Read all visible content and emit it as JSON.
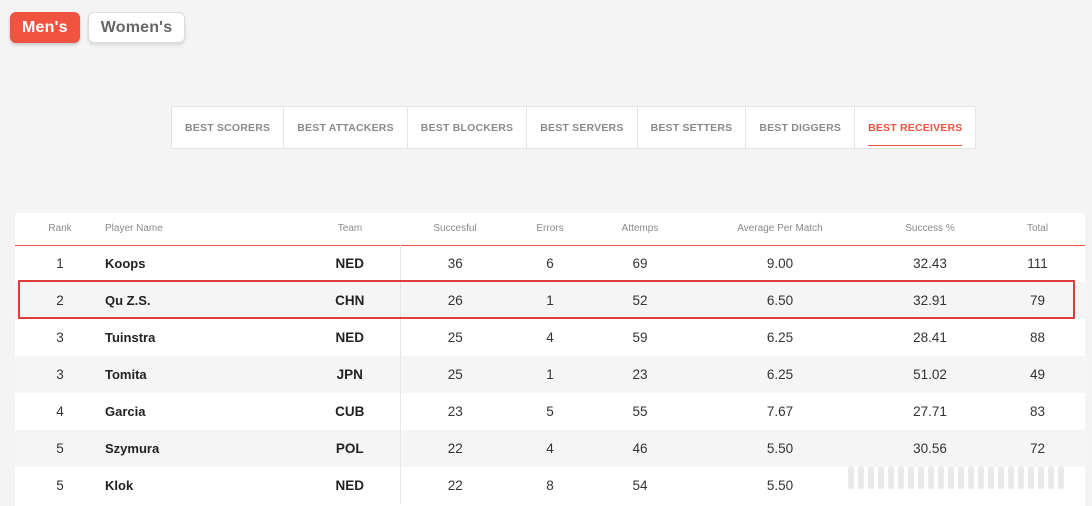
{
  "gender": {
    "mens_label": "Men's",
    "womens_label": "Women's"
  },
  "tabs": [
    {
      "label": "BEST SCORERS"
    },
    {
      "label": "BEST ATTACKERS"
    },
    {
      "label": "BEST BLOCKERS"
    },
    {
      "label": "BEST SERVERS"
    },
    {
      "label": "BEST SETTERS"
    },
    {
      "label": "BEST DIGGERS"
    },
    {
      "label": "BEST RECEIVERS"
    }
  ],
  "active_tab": "BEST RECEIVERS",
  "colors": {
    "accent": "#f0533f",
    "highlight": "#e33b3b"
  },
  "table": {
    "headers": {
      "rank": "Rank",
      "player": "Player Name",
      "team": "Team",
      "successful": "Succesful",
      "errors": "Errors",
      "attempts": "Attemps",
      "avg": "Average Per Match",
      "success_pct": "Success %",
      "total": "Total"
    },
    "rows": [
      {
        "rank": "1",
        "player": "Koops",
        "team": "NED",
        "successful": "36",
        "errors": "6",
        "attempts": "69",
        "avg": "9.00",
        "success_pct": "32.43",
        "total": "111"
      },
      {
        "rank": "2",
        "player": "Qu Z.S.",
        "team": "CHN",
        "successful": "26",
        "errors": "1",
        "attempts": "52",
        "avg": "6.50",
        "success_pct": "32.91",
        "total": "79"
      },
      {
        "rank": "3",
        "player": "Tuinstra",
        "team": "NED",
        "successful": "25",
        "errors": "4",
        "attempts": "59",
        "avg": "6.25",
        "success_pct": "28.41",
        "total": "88"
      },
      {
        "rank": "3",
        "player": "Tomita",
        "team": "JPN",
        "successful": "25",
        "errors": "1",
        "attempts": "23",
        "avg": "6.25",
        "success_pct": "51.02",
        "total": "49"
      },
      {
        "rank": "4",
        "player": "Garcia",
        "team": "CUB",
        "successful": "23",
        "errors": "5",
        "attempts": "55",
        "avg": "7.67",
        "success_pct": "27.71",
        "total": "83"
      },
      {
        "rank": "5",
        "player": "Szymura",
        "team": "POL",
        "successful": "22",
        "errors": "4",
        "attempts": "46",
        "avg": "5.50",
        "success_pct": "30.56",
        "total": "72"
      },
      {
        "rank": "5",
        "player": "Klok",
        "team": "NED",
        "successful": "22",
        "errors": "8",
        "attempts": "54",
        "avg": "5.50",
        "success_pct": "",
        "total": ""
      }
    ]
  }
}
